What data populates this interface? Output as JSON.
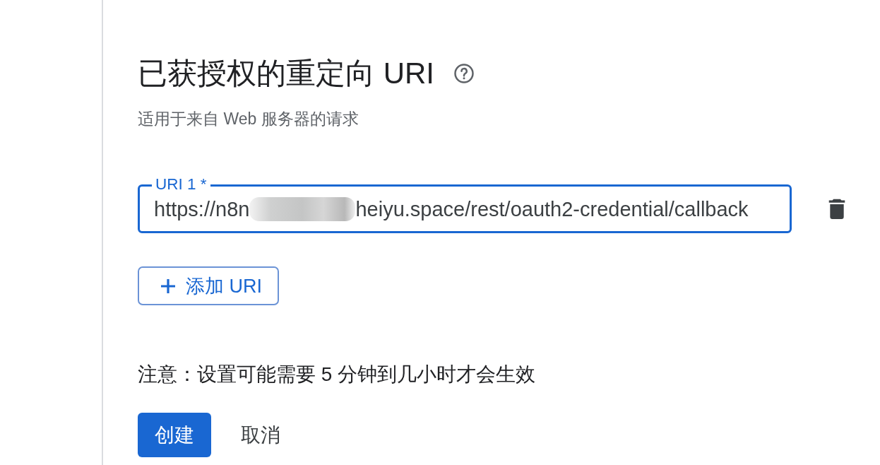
{
  "section": {
    "title": "已获授权的重定向 URI",
    "subtitle": "适用于来自 Web 服务器的请求"
  },
  "uris": [
    {
      "label": "URI 1 *",
      "value_parts": [
        "https://n8n",
        "heiyu.space/rest/oauth2-credential/callback"
      ],
      "focused": true
    }
  ],
  "add_button": {
    "label": "添加 URI"
  },
  "note": "注意：设置可能需要 5 分钟到几小时才会生效",
  "actions": [
    {
      "label": "创建",
      "kind": "primary"
    },
    {
      "label": "取消",
      "kind": "text"
    }
  ]
}
